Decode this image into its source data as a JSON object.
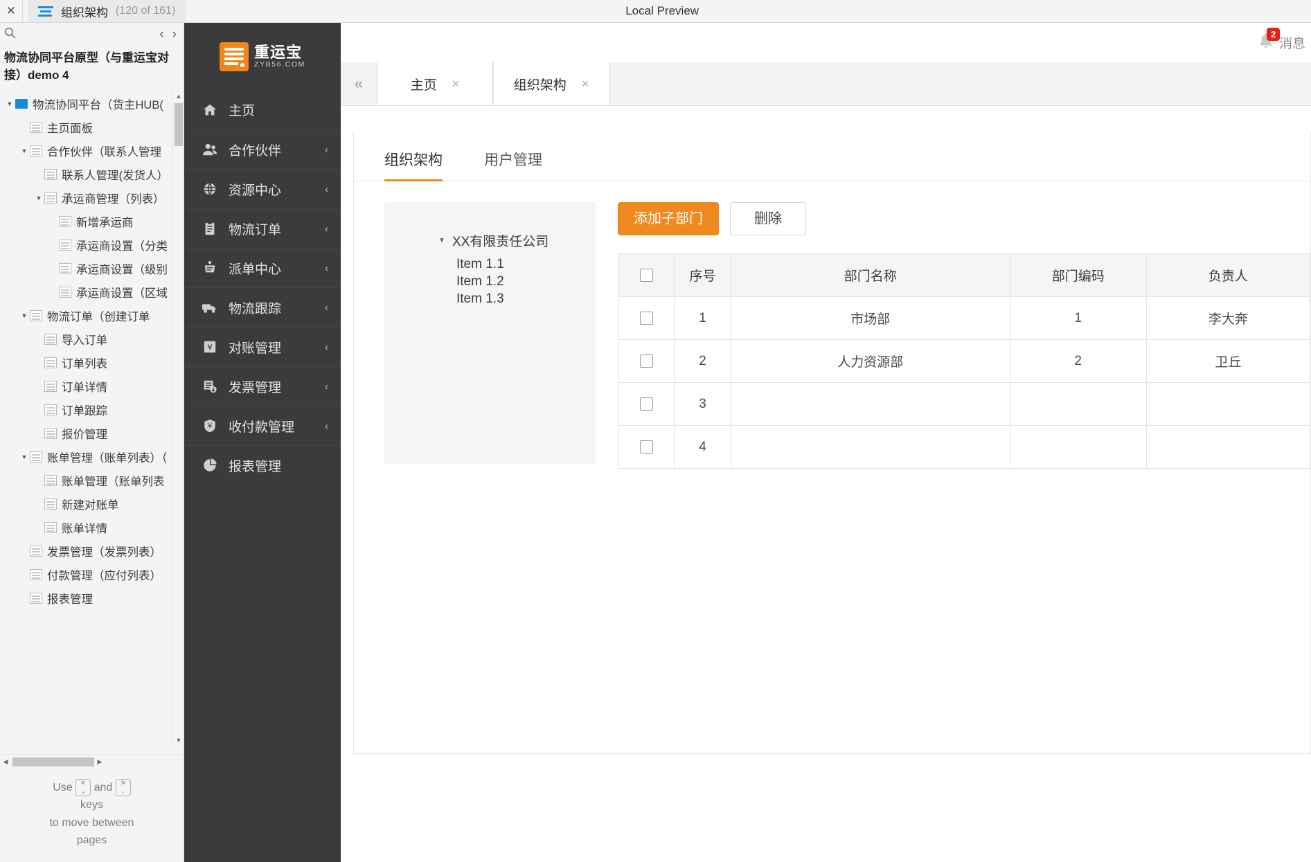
{
  "topbar": {
    "close_icon": "close-icon",
    "tab_title": "组织架构",
    "tab_count": "(120 of 161)",
    "center_title": "Local Preview"
  },
  "left_panel": {
    "search_icon": "search-icon",
    "prev_arrow": "‹",
    "next_arrow": "›",
    "project_title": "物流协同平台原型（与重运宝对接）demo 4",
    "tree": [
      {
        "label": "物流协同平台（货主HUB(",
        "depth": 0,
        "caret": "▼",
        "icon": "folder"
      },
      {
        "label": "主页面板",
        "depth": 1,
        "caret": "",
        "icon": "page"
      },
      {
        "label": "合作伙伴（联系人管理",
        "depth": 1,
        "caret": "▼",
        "icon": "page"
      },
      {
        "label": "联系人管理(发货人）",
        "depth": 2,
        "caret": "",
        "icon": "page"
      },
      {
        "label": "承运商管理（列表）",
        "depth": 2,
        "caret": "▼",
        "icon": "page"
      },
      {
        "label": "新增承运商",
        "depth": 3,
        "caret": "",
        "icon": "page"
      },
      {
        "label": "承运商设置（分类",
        "depth": 3,
        "caret": "",
        "icon": "page"
      },
      {
        "label": "承运商设置（级别",
        "depth": 3,
        "caret": "",
        "icon": "page"
      },
      {
        "label": "承运商设置（区域",
        "depth": 3,
        "caret": "",
        "icon": "page"
      },
      {
        "label": "物流订单（创建订单",
        "depth": 1,
        "caret": "▼",
        "icon": "page"
      },
      {
        "label": "导入订单",
        "depth": 2,
        "caret": "",
        "icon": "page"
      },
      {
        "label": "订单列表",
        "depth": 2,
        "caret": "",
        "icon": "page"
      },
      {
        "label": "订单详情",
        "depth": 2,
        "caret": "",
        "icon": "page"
      },
      {
        "label": "订单跟踪",
        "depth": 2,
        "caret": "",
        "icon": "page"
      },
      {
        "label": "报价管理",
        "depth": 2,
        "caret": "",
        "icon": "page"
      },
      {
        "label": "账单管理（账单列表）（",
        "depth": 1,
        "caret": "▼",
        "icon": "page"
      },
      {
        "label": "账单管理（账单列表",
        "depth": 2,
        "caret": "",
        "icon": "page"
      },
      {
        "label": "新建对账单",
        "depth": 2,
        "caret": "",
        "icon": "page"
      },
      {
        "label": "账单详情",
        "depth": 2,
        "caret": "",
        "icon": "page"
      },
      {
        "label": "发票管理（发票列表）",
        "depth": 1,
        "caret": "",
        "icon": "page"
      },
      {
        "label": "付款管理（应付列表）",
        "depth": 1,
        "caret": "",
        "icon": "page"
      },
      {
        "label": "报表管理",
        "depth": 1,
        "caret": "",
        "icon": "page"
      }
    ],
    "hint": {
      "use": "Use",
      "key_prev_top": "<",
      "key_prev_bottom": ",",
      "and": "and",
      "key_next_top": ">",
      "key_next_bottom": ".",
      "line2": "keys",
      "line3": "to move between",
      "line4": "pages"
    }
  },
  "app_nav": {
    "logo_cn": "重运宝",
    "logo_en": "ZYB56.COM",
    "items": [
      {
        "label": "主页",
        "icon": "home-icon",
        "chevron": ""
      },
      {
        "label": "合作伙伴",
        "icon": "users-icon",
        "chevron": "‹"
      },
      {
        "label": "资源中心",
        "icon": "globe-icon",
        "chevron": "‹"
      },
      {
        "label": "物流订单",
        "icon": "clipboard-icon",
        "chevron": "‹"
      },
      {
        "label": "派单中心",
        "icon": "dispatch-icon",
        "chevron": "‹"
      },
      {
        "label": "物流跟踪",
        "icon": "truck-icon",
        "chevron": "‹"
      },
      {
        "label": "对账管理",
        "icon": "yuan-note-icon",
        "chevron": "‹"
      },
      {
        "label": "发票管理",
        "icon": "invoice-icon",
        "chevron": "‹"
      },
      {
        "label": "收付款管理",
        "icon": "yuan-shield-icon",
        "chevron": "‹"
      },
      {
        "label": "报表管理",
        "icon": "piechart-icon",
        "chevron": ""
      }
    ]
  },
  "main": {
    "header": {
      "bell_icon": "bell-icon",
      "bell_badge": "2",
      "bell_text": "消息"
    },
    "collapse_icon": "«",
    "page_tabs": [
      {
        "label": "主页",
        "close": "×"
      },
      {
        "label": "组织架构",
        "close": "×"
      }
    ],
    "sub_tabs": [
      {
        "label": "组织架构",
        "active": true
      },
      {
        "label": "用户管理",
        "active": false
      }
    ],
    "org_tree": {
      "root_caret": "▼",
      "root": "XX有限责任公司",
      "children": [
        "Item 1.1",
        "Item 1.2",
        "Item 1.3"
      ]
    },
    "buttons": {
      "add": "添加子部门",
      "delete": "删除"
    },
    "table": {
      "headers": [
        "",
        "序号",
        "部门名称",
        "部门编码",
        "负责人"
      ],
      "rows": [
        {
          "idx": "1",
          "name": "市场部",
          "code": "1",
          "owner": "李大奔"
        },
        {
          "idx": "2",
          "name": "人力资源部",
          "code": "2",
          "owner": "卫丘"
        },
        {
          "idx": "3",
          "name": "",
          "code": "",
          "owner": ""
        },
        {
          "idx": "4",
          "name": "",
          "code": "",
          "owner": ""
        }
      ]
    }
  },
  "colors": {
    "accent_orange": "#ef8b1e",
    "nav_dark": "#3b3b3b",
    "badge_red": "#e8201a",
    "link_blue": "#1a8bd4"
  }
}
